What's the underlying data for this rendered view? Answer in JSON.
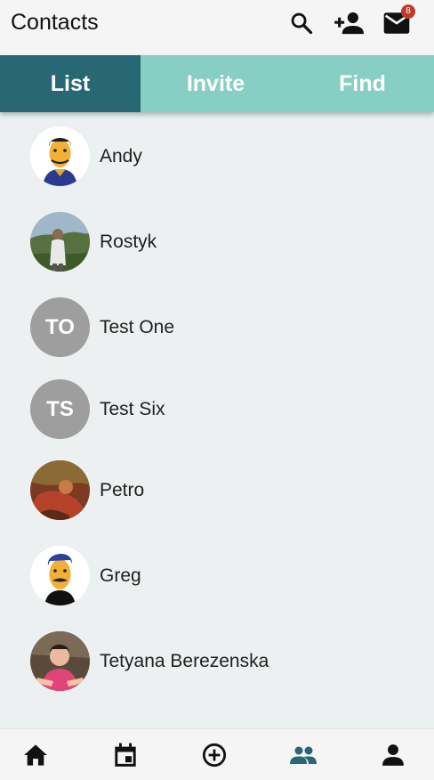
{
  "appbar": {
    "title": "Contacts",
    "actions": [
      {
        "icon": "search-icon"
      },
      {
        "icon": "add-person-icon"
      },
      {
        "icon": "mail-icon",
        "badge": "8"
      }
    ]
  },
  "tabs": [
    {
      "label": "List",
      "active": true
    },
    {
      "label": "Invite",
      "active": false
    },
    {
      "label": "Find",
      "active": false
    }
  ],
  "contacts": [
    {
      "name": "Andy",
      "avatar": "cartoon-man-photo"
    },
    {
      "name": "Rostyk",
      "avatar": "outdoor-photo"
    },
    {
      "name": "Test One",
      "initials": "TO"
    },
    {
      "name": "Test Six",
      "initials": "TS"
    },
    {
      "name": "Petro",
      "avatar": "painting-photo"
    },
    {
      "name": "Greg",
      "avatar": "cartoon-mustache-photo"
    },
    {
      "name": "Tetyana Berezenska",
      "avatar": "child-photo"
    }
  ],
  "bottom_nav": [
    {
      "icon": "home-icon",
      "active": false
    },
    {
      "icon": "calendar-icon",
      "active": false
    },
    {
      "icon": "add-circle-icon",
      "active": false
    },
    {
      "icon": "people-icon",
      "active": true
    },
    {
      "icon": "person-icon",
      "active": false
    }
  ],
  "colors": {
    "tab_active": "#276874",
    "tab_inactive": "#87cec4",
    "background": "#ecf0f1",
    "avatar_initials_bg": "#9e9e9e",
    "nav_active": "#276874",
    "badge": "#c0392b"
  }
}
